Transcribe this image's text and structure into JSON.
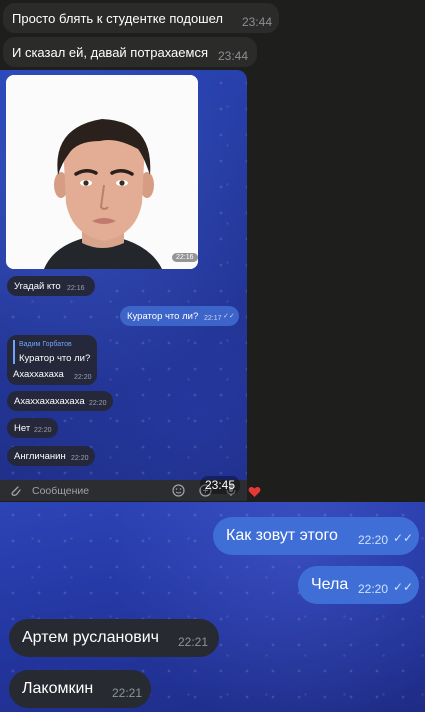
{
  "top_chat": {
    "messages": [
      {
        "text": "Просто блять к студентке подошел",
        "time": "23:44"
      },
      {
        "text": "И сказал ей, давай потрахаемся",
        "time": "23:44"
      }
    ]
  },
  "inner_screenshot": {
    "photo_time": "22:16",
    "messages": [
      {
        "text": "Угадай кто",
        "time": "22:16",
        "outgoing": false
      },
      {
        "text": "Куратор что ли?",
        "time": "22:17",
        "outgoing": true
      },
      {
        "reply_author": "Вадим Горбатов",
        "reply_text": "Куратор что ли?",
        "text": "Ахаххахаха",
        "time": "22:20",
        "outgoing": false
      },
      {
        "text": "Ахаххахахахаха",
        "time": "22:20",
        "outgoing": false
      },
      {
        "text": "Нет",
        "time": "22:20",
        "outgoing": false
      },
      {
        "text": "Англичанин",
        "time": "22:20",
        "outgoing": false
      }
    ],
    "input_placeholder": "Сообщение"
  },
  "overlay_time": "23:45",
  "reaction": "heart-icon",
  "bottom_chat": {
    "messages": [
      {
        "text": "Как зовут этого",
        "time": "22:20",
        "outgoing": true
      },
      {
        "text": "Чела",
        "time": "22:20",
        "outgoing": true
      },
      {
        "text": "Артем русланович",
        "time": "22:21",
        "outgoing": false
      },
      {
        "text": "Лакомкин",
        "time": "22:21",
        "outgoing": false
      }
    ]
  },
  "colors": {
    "outgoing_bubble": "#3f6fd6",
    "incoming_bubble": "#272a31",
    "chat_background": "#2336a0",
    "reaction_heart": "#e53935"
  }
}
